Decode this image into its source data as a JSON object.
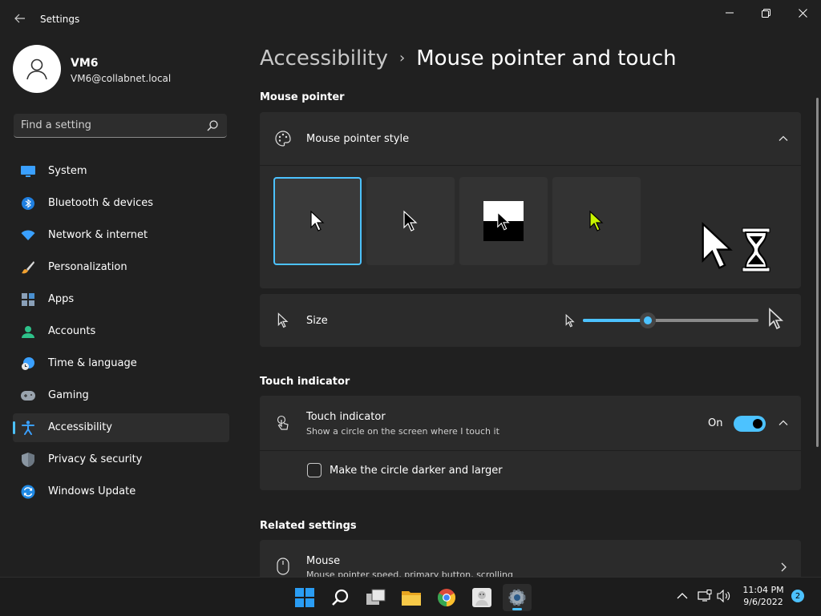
{
  "window": {
    "title": "Settings",
    "icons": {
      "back": "back-arrow-icon",
      "minimize": "minimize-icon",
      "maximize": "restore-icon",
      "close": "close-icon"
    }
  },
  "profile": {
    "name": "VM6",
    "email": "VM6@collabnet.local",
    "avatar_icon": "person-icon"
  },
  "search": {
    "placeholder": "Find a setting",
    "icon": "search-icon"
  },
  "sidebar": {
    "items": [
      {
        "label": "System",
        "icon": "monitor-icon"
      },
      {
        "label": "Bluetooth & devices",
        "icon": "bluetooth-icon"
      },
      {
        "label": "Network & internet",
        "icon": "wifi-icon"
      },
      {
        "label": "Personalization",
        "icon": "brush-icon"
      },
      {
        "label": "Apps",
        "icon": "apps-icon"
      },
      {
        "label": "Accounts",
        "icon": "person-icon"
      },
      {
        "label": "Time & language",
        "icon": "clock-globe-icon"
      },
      {
        "label": "Gaming",
        "icon": "gamepad-icon"
      },
      {
        "label": "Accessibility",
        "icon": "accessibility-icon",
        "active": true
      },
      {
        "label": "Privacy & security",
        "icon": "shield-icon"
      },
      {
        "label": "Windows Update",
        "icon": "update-icon"
      }
    ]
  },
  "breadcrumb": {
    "parent": "Accessibility",
    "separator": "›",
    "current": "Mouse pointer and touch"
  },
  "mouse_pointer": {
    "section_title": "Mouse pointer",
    "style_card": {
      "title": "Mouse pointer style",
      "icon": "palette-icon",
      "expanded": true,
      "options": [
        {
          "name": "White",
          "selected": true
        },
        {
          "name": "Black",
          "selected": false
        },
        {
          "name": "Inverted",
          "selected": false
        },
        {
          "name": "Custom",
          "selected": false,
          "color": "#c8f500"
        }
      ]
    },
    "size_card": {
      "title": "Size",
      "icon": "cursor-icon",
      "slider_value": 0.37
    }
  },
  "touch_indicator": {
    "section_title": "Touch indicator",
    "card": {
      "title": "Touch indicator",
      "subtitle": "Show a circle on the screen where I touch it",
      "icon": "touch-icon",
      "state_label": "On",
      "enabled": true
    },
    "option": {
      "label": "Make the circle darker and larger",
      "checked": false
    }
  },
  "related": {
    "section_title": "Related settings",
    "mouse": {
      "title": "Mouse",
      "subtitle": "Mouse pointer speed, primary button, scrolling",
      "icon": "mouse-icon"
    }
  },
  "taskbar": {
    "apps": [
      {
        "name": "start-icon"
      },
      {
        "name": "search-icon"
      },
      {
        "name": "task-view-icon"
      },
      {
        "name": "file-explorer-icon"
      },
      {
        "name": "chrome-icon"
      },
      {
        "name": "app-icon"
      },
      {
        "name": "settings-gear-icon",
        "active": true
      }
    ],
    "tray": {
      "time": "11:04 PM",
      "date": "9/6/2022",
      "notifications": "2"
    }
  },
  "colors": {
    "accent": "#4cc2ff",
    "background": "#202020",
    "card": "#2b2b2b",
    "custom_pointer": "#c8f500"
  }
}
